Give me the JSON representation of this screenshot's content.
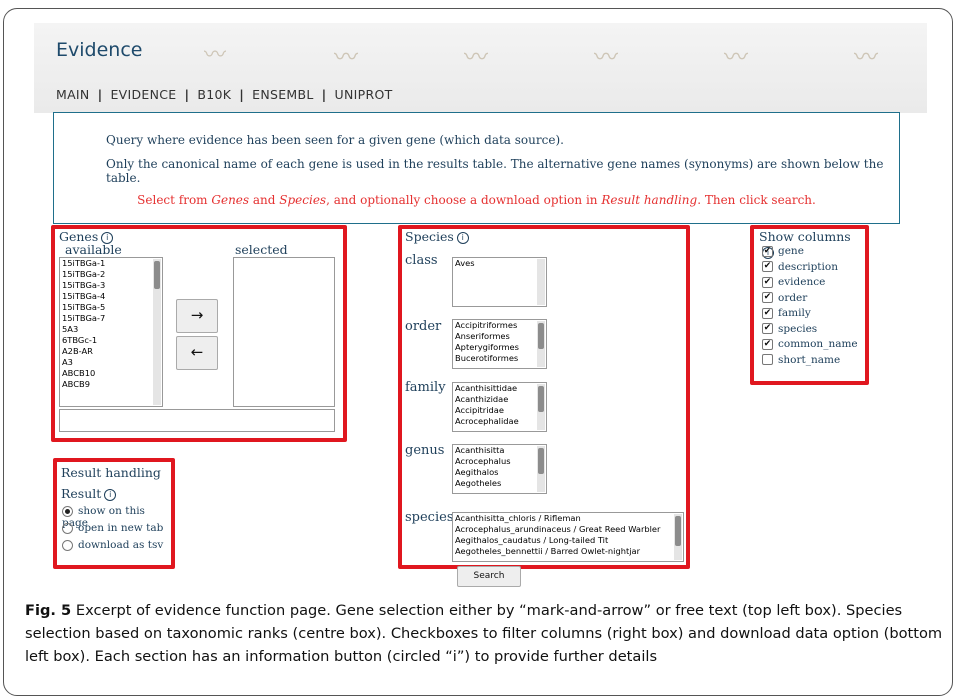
{
  "header": {
    "title": "Evidence",
    "nav": [
      "MAIN",
      "EVIDENCE",
      "B10K",
      "ENSEMBL",
      "UNIPROT"
    ],
    "separator": "|"
  },
  "info": {
    "line1": "Query where evidence has been seen for a given gene (which data source).",
    "line2": "Only the canonical name of each gene is used in the results table. The alternative gene names (synonyms) are shown below the table.",
    "line3_a": "Select from ",
    "line3_genes": "Genes",
    "line3_b": " and ",
    "line3_species": "Species",
    "line3_c": ", and optionally choose a download option in ",
    "line3_rh": "Result handling",
    "line3_d": ". Then click search."
  },
  "genes": {
    "title": "Genes",
    "available_label": "available",
    "selected_label": "selected",
    "available": [
      "15iTBGa-1",
      "15iTBGa-2",
      "15iTBGa-3",
      "15iTBGa-4",
      "15iTBGa-5",
      "15iTBGa-7",
      "5A3",
      "6TBGc-1",
      "A2B-AR",
      "A3",
      "ABCB10",
      "ABCB9"
    ],
    "move_right": "→",
    "move_left": "←",
    "free_text_value": ""
  },
  "species": {
    "title": "Species",
    "class_label": "class",
    "class": [
      "Aves"
    ],
    "order_label": "order",
    "order": [
      "Accipitriformes",
      "Anseriformes",
      "Apterygiformes",
      "Bucerotiformes"
    ],
    "family_label": "family",
    "family": [
      "Acanthisittidae",
      "Acanthizidae",
      "Accipitridae",
      "Acrocephalidae"
    ],
    "genus_label": "genus",
    "genus": [
      "Acanthisitta",
      "Acrocephalus",
      "Aegithalos",
      "Aegotheles"
    ],
    "species_label": "species",
    "species": [
      "Acanthisitta_chloris / Rifleman",
      "Acrocephalus_arundinaceus / Great Reed Warbler",
      "Aegithalos_caudatus / Long-tailed Tit",
      "Aegotheles_bennettii / Barred Owlet-nightjar"
    ],
    "search_label": "Search"
  },
  "columns": {
    "title": "Show columns",
    "items": [
      {
        "label": "gene",
        "checked": true
      },
      {
        "label": "description",
        "checked": true
      },
      {
        "label": "evidence",
        "checked": true
      },
      {
        "label": "order",
        "checked": true
      },
      {
        "label": "family",
        "checked": true
      },
      {
        "label": "species",
        "checked": true
      },
      {
        "label": "common_name",
        "checked": true
      },
      {
        "label": "short_name",
        "checked": false
      }
    ]
  },
  "result": {
    "title": "Result handling",
    "subtitle": "Result",
    "options": [
      {
        "label": "show on this page",
        "selected": true
      },
      {
        "label": "open in new tab",
        "selected": false
      },
      {
        "label": "download as tsv",
        "selected": false
      }
    ]
  },
  "info_icon": "ⓘ",
  "caption": {
    "fig": "Fig. 5",
    "text": "  Excerpt of evidence function page. Gene selection either by “mark-and-arrow” or free text (top left box). Species selection based on taxonomic ranks (centre box). Checkboxes to filter columns (right box) and download data option (bottom left box). Each section has an information button (circled “i”) to provide further details"
  },
  "colors": {
    "accent_red": "#e0171f",
    "title_blue": "#1e4a6b",
    "info_red": "#e53030"
  }
}
